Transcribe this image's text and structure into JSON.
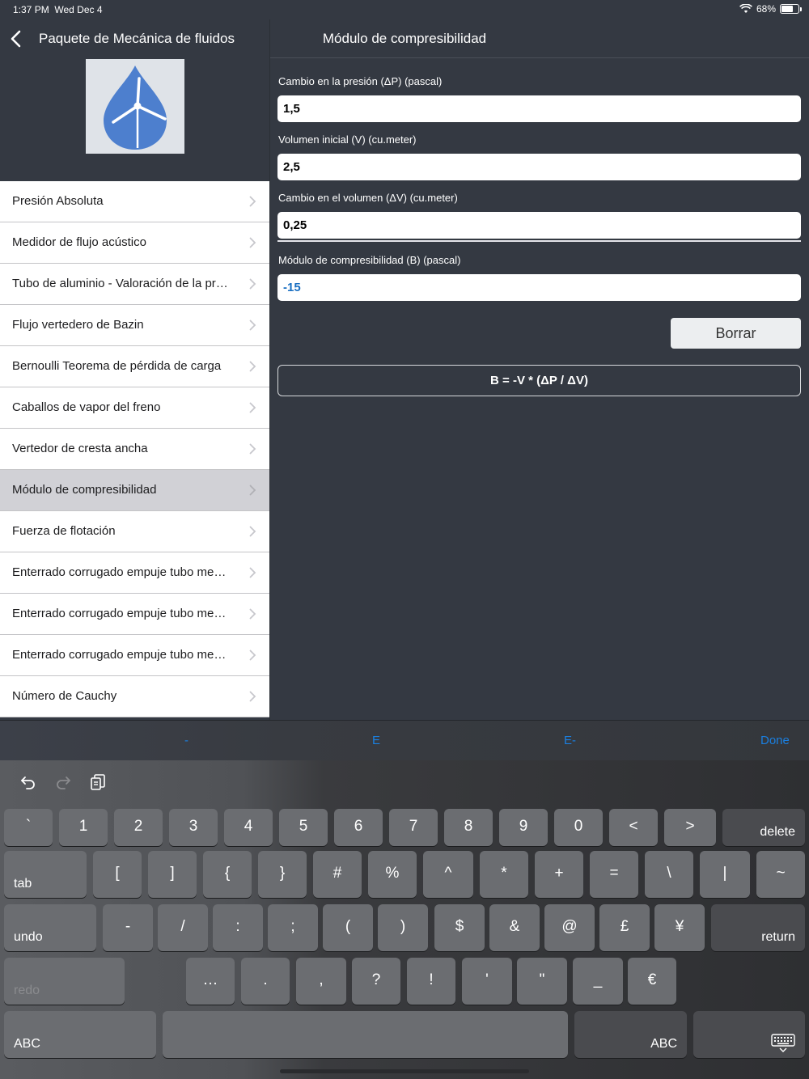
{
  "status": {
    "time": "1:37 PM",
    "date": "Wed Dec 4",
    "battery": "68%"
  },
  "master": {
    "back_title": "Paquete de Mecánica de fluidos",
    "items": [
      {
        "label": "Presión Absoluta"
      },
      {
        "label": "Medidor de flujo acústico"
      },
      {
        "label": "Tubo de aluminio - Valoración de la pr…"
      },
      {
        "label": "Flujo vertedero de Bazin"
      },
      {
        "label": "Bernoulli Teorema de pérdida de carga"
      },
      {
        "label": "Caballos de vapor del freno"
      },
      {
        "label": "Vertedor de cresta ancha"
      },
      {
        "label": "Módulo de compresibilidad"
      },
      {
        "label": "Fuerza de flotación"
      },
      {
        "label": "Enterrado corrugado empuje tubo me…"
      },
      {
        "label": "Enterrado corrugado empuje tubo me…"
      },
      {
        "label": "Enterrado corrugado empuje tubo me…"
      },
      {
        "label": "Número de Cauchy"
      }
    ],
    "selected_index": 7
  },
  "detail": {
    "title": "Módulo de compresibilidad",
    "fields": [
      {
        "label": "Cambio en la presión (ΔP) (pascal)",
        "value": "1,5"
      },
      {
        "label": "Volumen inicial (V) (cu.meter)",
        "value": "2,5"
      },
      {
        "label": "Cambio en el volumen (ΔV) (cu.meter)",
        "value": "0,25"
      }
    ],
    "result": {
      "label": "Módulo de compresibilidad (B) (pascal)",
      "value": "-15"
    },
    "clear_label": "Borrar",
    "formula": "B = -V * (ΔP / ΔV)"
  },
  "accessory": {
    "minus": "-",
    "e": "E",
    "e_minus": "E-",
    "done": "Done"
  },
  "keyboard": {
    "row1": [
      "`",
      "1",
      "2",
      "3",
      "4",
      "5",
      "6",
      "7",
      "8",
      "9",
      "0",
      "<",
      ">"
    ],
    "delete": "delete",
    "tab": "tab",
    "row2": [
      "[",
      "]",
      "{",
      "}",
      "#",
      "%",
      "^",
      "*",
      "+",
      "=",
      "\\",
      "|",
      "~"
    ],
    "undo": "undo",
    "row3": [
      "-",
      "/",
      ":",
      ";",
      "(",
      ")",
      "$",
      "&",
      "@",
      "£",
      "¥"
    ],
    "return": "return",
    "redo": "redo",
    "row4": [
      "…",
      ".",
      ",",
      "?",
      "!",
      "'",
      "\"",
      "_",
      "€"
    ],
    "abc_left": "ABC",
    "abc_right": "ABC"
  },
  "colors": {
    "accent": "#1a7fe0",
    "background": "#343942",
    "result_text": "#1a6fc2"
  }
}
